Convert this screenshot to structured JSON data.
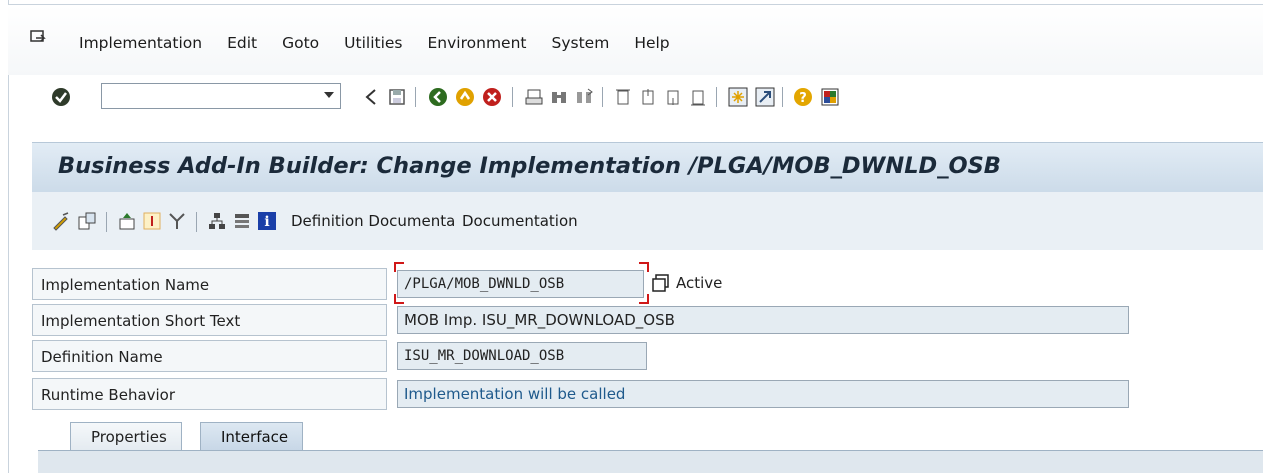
{
  "menu": {
    "items": [
      {
        "label": "Implementation"
      },
      {
        "label": "Edit"
      },
      {
        "label": "Goto"
      },
      {
        "label": "Utilities"
      },
      {
        "label": "Environment"
      },
      {
        "label": "System"
      },
      {
        "label": "Help"
      }
    ]
  },
  "toolbar": {
    "command_field_value": "",
    "icons": [
      "enter-icon",
      "back-icon",
      "save-icon",
      "back-green-icon",
      "exit-icon",
      "cancel-icon",
      "print-icon",
      "find-icon",
      "find-next-icon",
      "first-page-icon",
      "previous-page-icon",
      "next-page-icon",
      "last-page-icon",
      "new-session-icon",
      "shortcut-icon",
      "help-icon",
      "customize-layout-icon"
    ]
  },
  "title_bar": {
    "title": "Business Add-In Builder: Change Implementation /PLGA/MOB_DWNLD_OSB"
  },
  "app_toolbar": {
    "definition_doc_label": "Definition Documenta",
    "documentation_label": "Documentation"
  },
  "form": {
    "impl_name_label": "Implementation Name",
    "impl_name_value": "/PLGA/MOB_DWNLD_OSB",
    "impl_status": "Active",
    "short_text_label": "Implementation Short Text",
    "short_text_value": "MOB Imp. ISU_MR_DOWNLOAD_OSB",
    "definition_label": "Definition Name",
    "definition_value": "ISU_MR_DOWNLOAD_OSB",
    "runtime_label": "Runtime Behavior",
    "runtime_value": "Implementation will be called"
  },
  "tabs": [
    {
      "label": "Properties",
      "active": false
    },
    {
      "label": "Interface",
      "active": true
    }
  ],
  "colors": {
    "title_bg": "#ccdbe9",
    "toolbar_bg": "#eaf0f5",
    "focus": "#d01818",
    "runtime_text": "#1f5a8c"
  }
}
